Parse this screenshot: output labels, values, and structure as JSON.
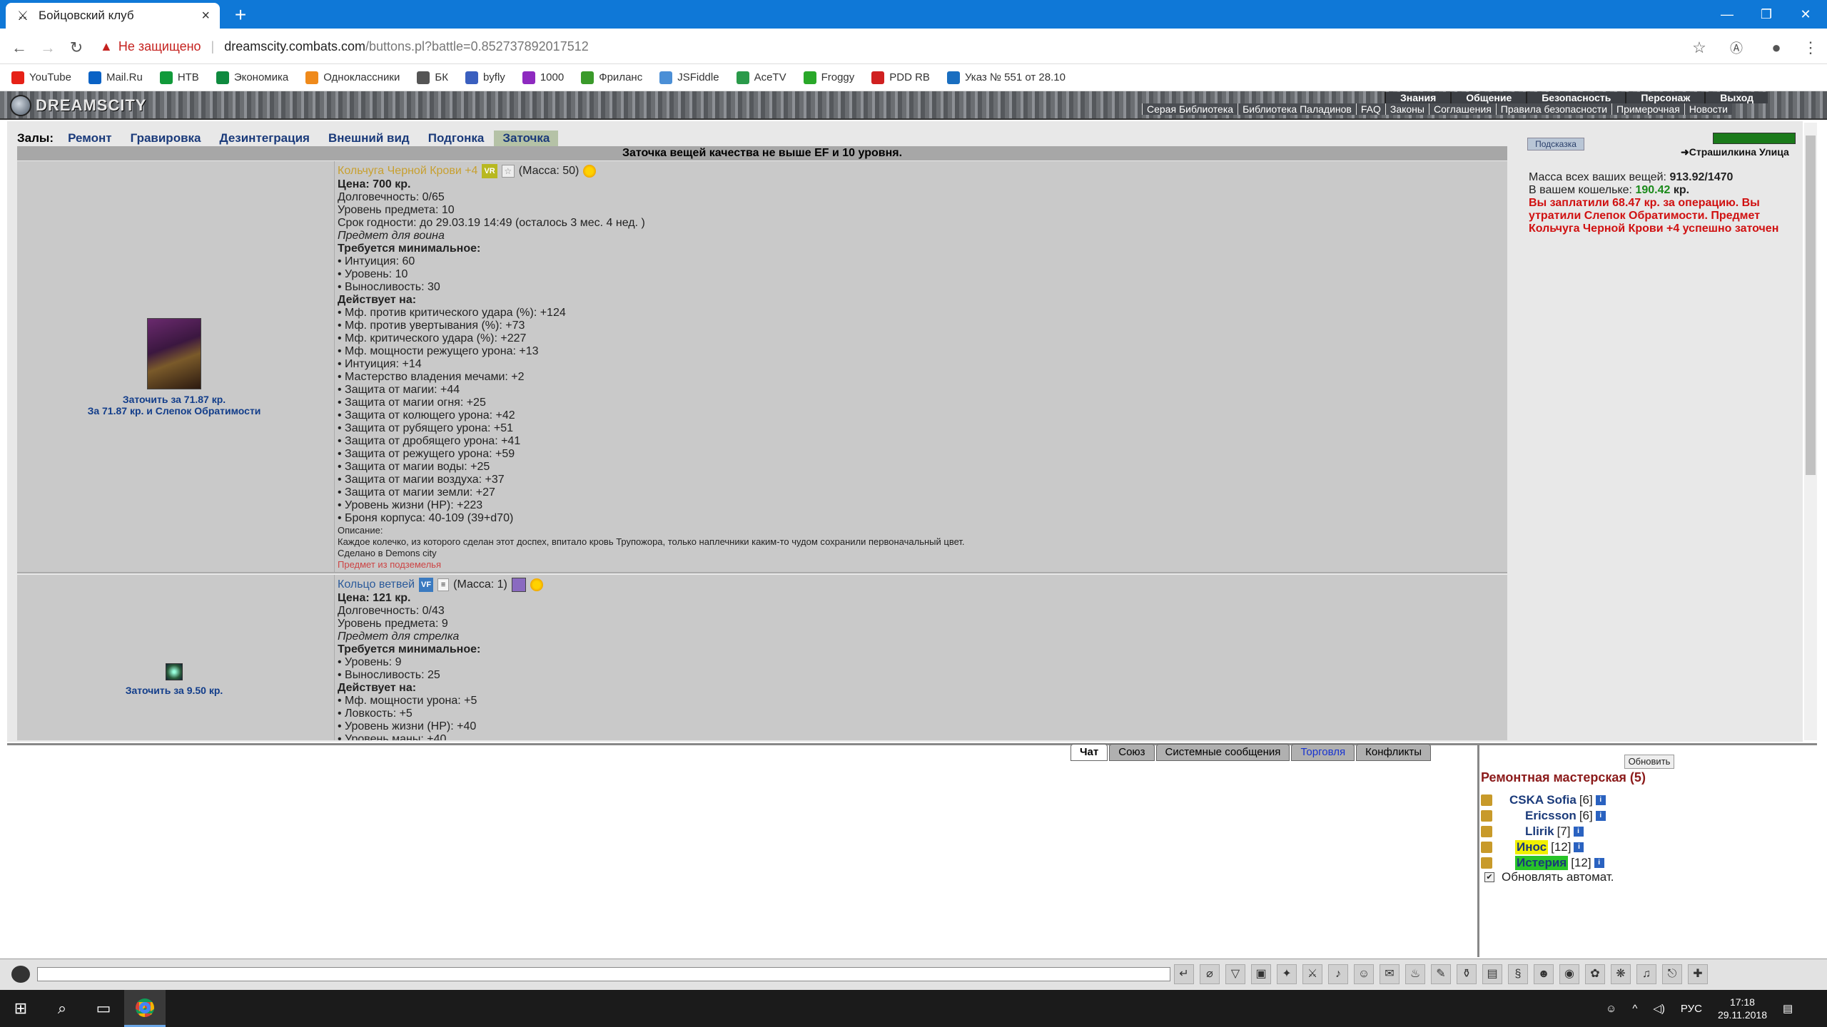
{
  "browser": {
    "tab_title": "Бойцовский клуб",
    "insecure_label": "Не защищено",
    "url_host": "dreamscity.combats.com",
    "url_path": "/buttons.pl?battle=0.852737892017512",
    "bookmarks": [
      {
        "label": "YouTube",
        "color": "#e62117"
      },
      {
        "label": "Mail.Ru",
        "color": "#0a62c5"
      },
      {
        "label": "НТВ",
        "color": "#119a3a"
      },
      {
        "label": "Экономика",
        "color": "#0f8a3f"
      },
      {
        "label": "Одноклассники",
        "color": "#ef8a1b"
      },
      {
        "label": "БК",
        "color": "#555555"
      },
      {
        "label": "byfly",
        "color": "#3a5fbf"
      },
      {
        "label": "1000",
        "color": "#8e2ac0"
      },
      {
        "label": "Фриланс",
        "color": "#3a9a2a"
      },
      {
        "label": "JSFiddle",
        "color": "#4b8fd6"
      },
      {
        "label": "AceTV",
        "color": "#2a9a4a"
      },
      {
        "label": "Froggy",
        "color": "#29a829"
      },
      {
        "label": "PDD RB",
        "color": "#d02020"
      },
      {
        "label": "Указ № 551 от 28.10",
        "color": "#1a6ec0"
      }
    ]
  },
  "game": {
    "logo": "DREAMSCITY",
    "topnav": [
      "Знания",
      "Общение",
      "Безопасность",
      "Персонаж",
      "Выход"
    ],
    "subnav": [
      "Серая Библиотека",
      "Библиотека Паладинов",
      "FAQ",
      "Законы",
      "Соглашения",
      "Правила безопасности",
      "Примерочная",
      "Новости"
    ]
  },
  "halls": {
    "label": "Залы:",
    "items": [
      "Ремонт",
      "Гравировка",
      "Дезинтеграция",
      "Внешний вид",
      "Подгонка",
      "Заточка"
    ],
    "active": "Заточка"
  },
  "notice": "Заточка вещей качества не выше EF и 10 уровня.",
  "item1": {
    "name": "Кольчуга Черной Крови +4",
    "badge": "VR",
    "mass": "(Масса: 50)",
    "price": "Цена: 700 кр.",
    "durability": "Долговечность: 0/65",
    "level": "Уровень предмета: 10",
    "expiry": "Срок годности: до 29.03.19 14:49 (осталось 3 мес. 4 нед. )",
    "for": "Предмет для воина",
    "req_title": "Требуется минимальное:",
    "reqs": [
      "• Интуиция: 60",
      "• Уровень: 10",
      "• Выносливость: 30"
    ],
    "acts_title": "Действует на:",
    "acts": [
      "• Мф. против критического удара (%): +124",
      "• Мф. против увертывания (%): +73",
      "• Мф. критического удара (%): +227",
      "• Мф. мощности режущего урона: +13",
      "• Интуиция: +14",
      "• Мастерство владения мечами: +2",
      "• Защита от магии: +44",
      "• Защита от магии огня: +25",
      "• Защита от колющего урона: +42",
      "• Защита от рубящего урона: +51",
      "• Защита от дробящего урона: +41",
      "• Защита от режущего урона: +59",
      "• Защита от магии воды: +25",
      "• Защита от магии воздуха: +37",
      "• Защита от магии земли: +27",
      "• Уровень жизни (HP): +223",
      "• Броня корпуса: 40-109 (39+d70)"
    ],
    "desc_title": "Описание:",
    "desc": "Каждое колечко, из которого сделан этот доспех, впитало кровь Трупожора, только наплечники каким-то чудом сохранили первоначальный цвет.",
    "made": "Сделано в Demons city",
    "dungeon": "Предмет из подземелья",
    "action1": "Заточить за 71.87 кр.",
    "action2": "За 71.87 кр. и Слепок Обратимости"
  },
  "item2": {
    "name": "Кольцо ветвей",
    "badge": "VF",
    "mass": "(Масса: 1)",
    "price": "Цена: 121 кр.",
    "durability": "Долговечность: 0/43",
    "level": "Уровень предмета: 9",
    "for": "Предмет для стрелка",
    "req_title": "Требуется минимальное:",
    "reqs": [
      "• Уровень: 9",
      "• Выносливость: 25"
    ],
    "acts_title": "Действует на:",
    "acts": [
      "• Мф. мощности урона: +5",
      "• Ловкость: +5",
      "• Уровень жизни (HP): +40",
      "• Уровень маны: +40"
    ],
    "action1": "Заточить за 9.50 кр."
  },
  "rpanel": {
    "hint": "Подсказка",
    "location": "Страшилкина Улица",
    "mass_label": "Масса всех ваших вещей:",
    "mass_value": "913.92/1470",
    "wallet_label": "В вашем кошельке:",
    "wallet_value": "190.42",
    "wallet_unit": "кр.",
    "message": "Вы заплатили 68.47 кр. за операцию. Вы утратили Слепок Обратимости. Предмет Кольчуга Черной Крови +4 успешно заточен"
  },
  "chat": {
    "tabs": [
      "Чат",
      "Союз",
      "Системные сообщения",
      "Торговля",
      "Конфликты"
    ]
  },
  "online": {
    "refresh": "Обновить",
    "room": "Ремонтная мастерская (5)",
    "users": [
      {
        "name": "CSKA Sofia",
        "level": "[6]"
      },
      {
        "name": "Ericsson",
        "level": "[6]"
      },
      {
        "name": "Llirik",
        "level": "[7]"
      },
      {
        "name": "Инос",
        "level": "[12]"
      },
      {
        "name": "Истерия",
        "level": "[12]"
      }
    ],
    "autorefresh": "Обновлять автомат."
  },
  "taskbar": {
    "lang": "РУС",
    "time": "17:18",
    "date": "29.11.2018"
  }
}
